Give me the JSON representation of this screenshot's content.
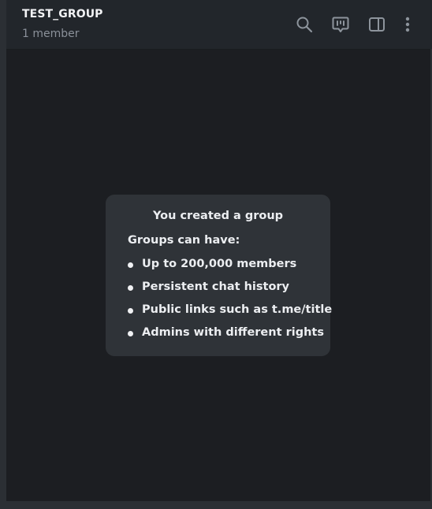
{
  "header": {
    "title": "TEST_GROUP",
    "subtitle": "1 member",
    "icons": [
      "search-icon",
      "discussion-icon",
      "sidebar-toggle-icon",
      "more-vertical-icon"
    ]
  },
  "notice": {
    "title": "You created a group",
    "lead": "Groups can have:",
    "features": [
      "Up to 200,000 members",
      "Persistent chat history",
      "Public links such as t.me/title",
      "Admins with different rights"
    ]
  },
  "colors": {
    "header_bg": "#22262b",
    "chat_bg": "#1c1e22",
    "notice_bg": "#2f3338",
    "icon": "#8d949c",
    "text_primary": "#f2f3f5",
    "text_secondary": "#8a9099"
  }
}
